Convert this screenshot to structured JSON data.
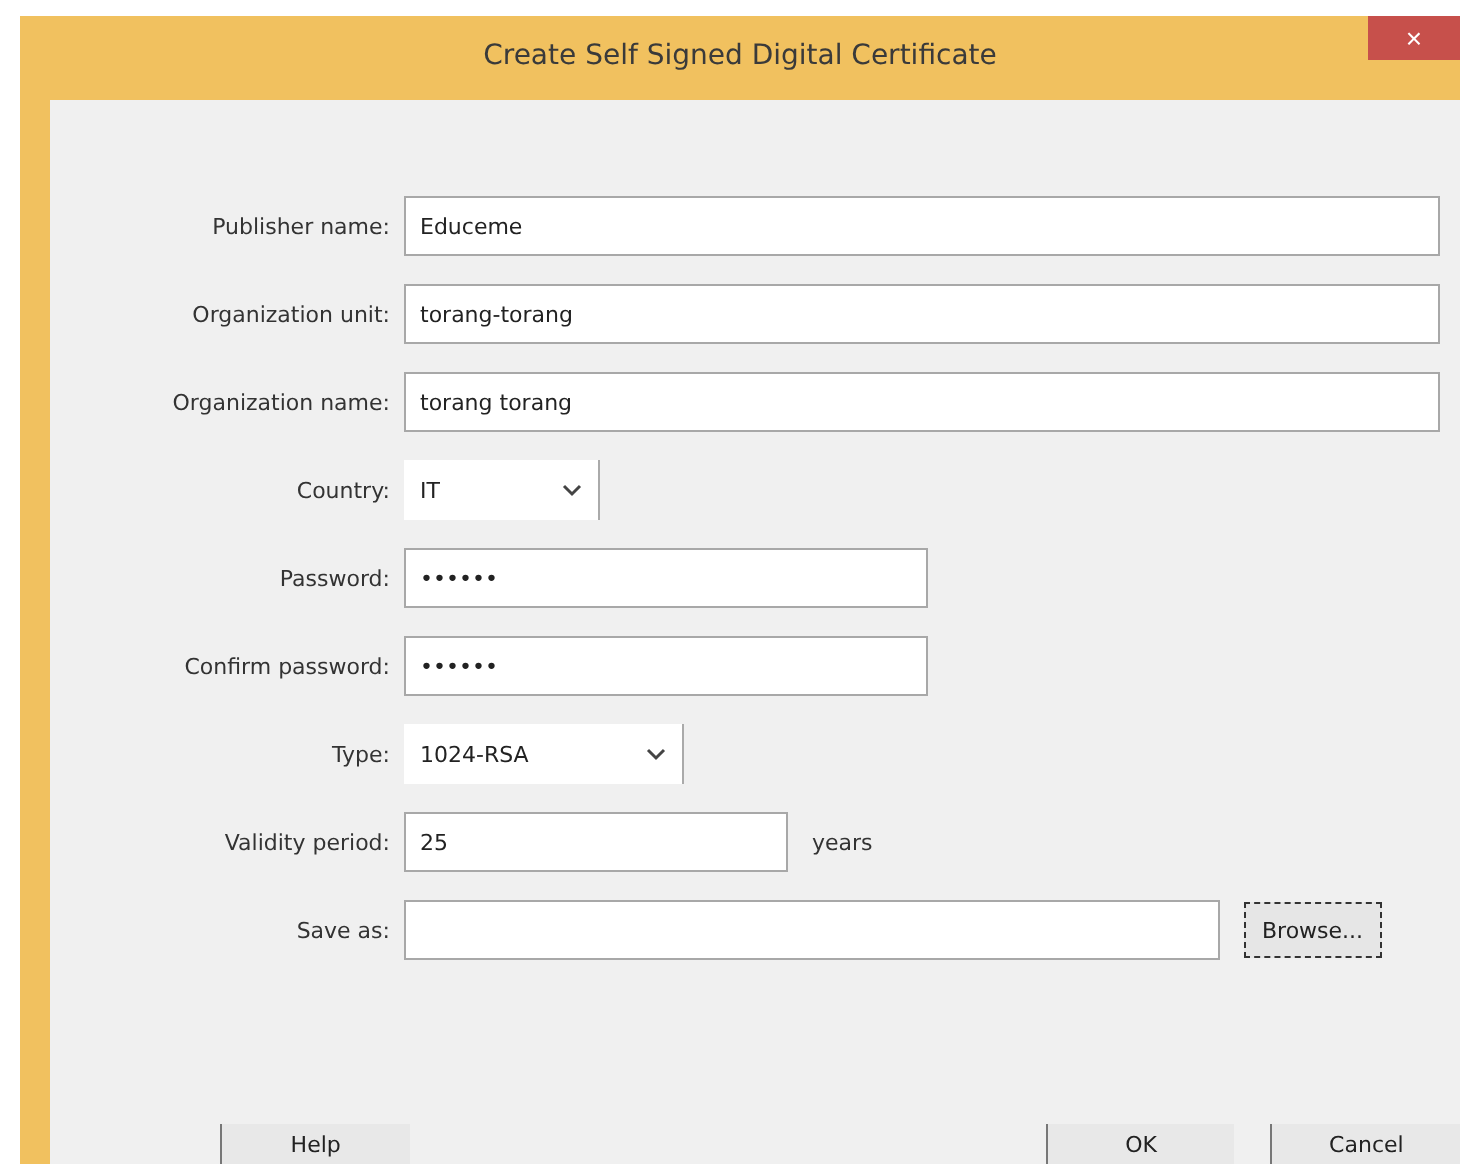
{
  "window": {
    "title": "Create Self Signed Digital Certificate",
    "close": "×"
  },
  "fields": [
    {
      "kind": "text",
      "label": "Publisher name:",
      "value": "Educeme"
    },
    {
      "kind": "text",
      "label": "Organization unit:",
      "value": "torang-torang"
    },
    {
      "kind": "text",
      "label": "Organization name:",
      "value": "torang torang"
    },
    {
      "kind": "select",
      "label": "Country:",
      "value": "IT"
    },
    {
      "kind": "password",
      "label": "Password:",
      "value": "••••••"
    },
    {
      "kind": "password",
      "label": "Confirm password:",
      "value": "••••••"
    },
    {
      "kind": "select",
      "label": "Type:",
      "value": "1024-RSA"
    },
    {
      "kind": "period",
      "label": "Validity period:",
      "value": "25",
      "unit": "years"
    },
    {
      "kind": "file",
      "label": "Save as:",
      "button": "Browse..."
    }
  ],
  "buttons": [
    {
      "label": "Help"
    },
    {
      "label": "OK"
    },
    {
      "label": "Cancel"
    }
  ]
}
